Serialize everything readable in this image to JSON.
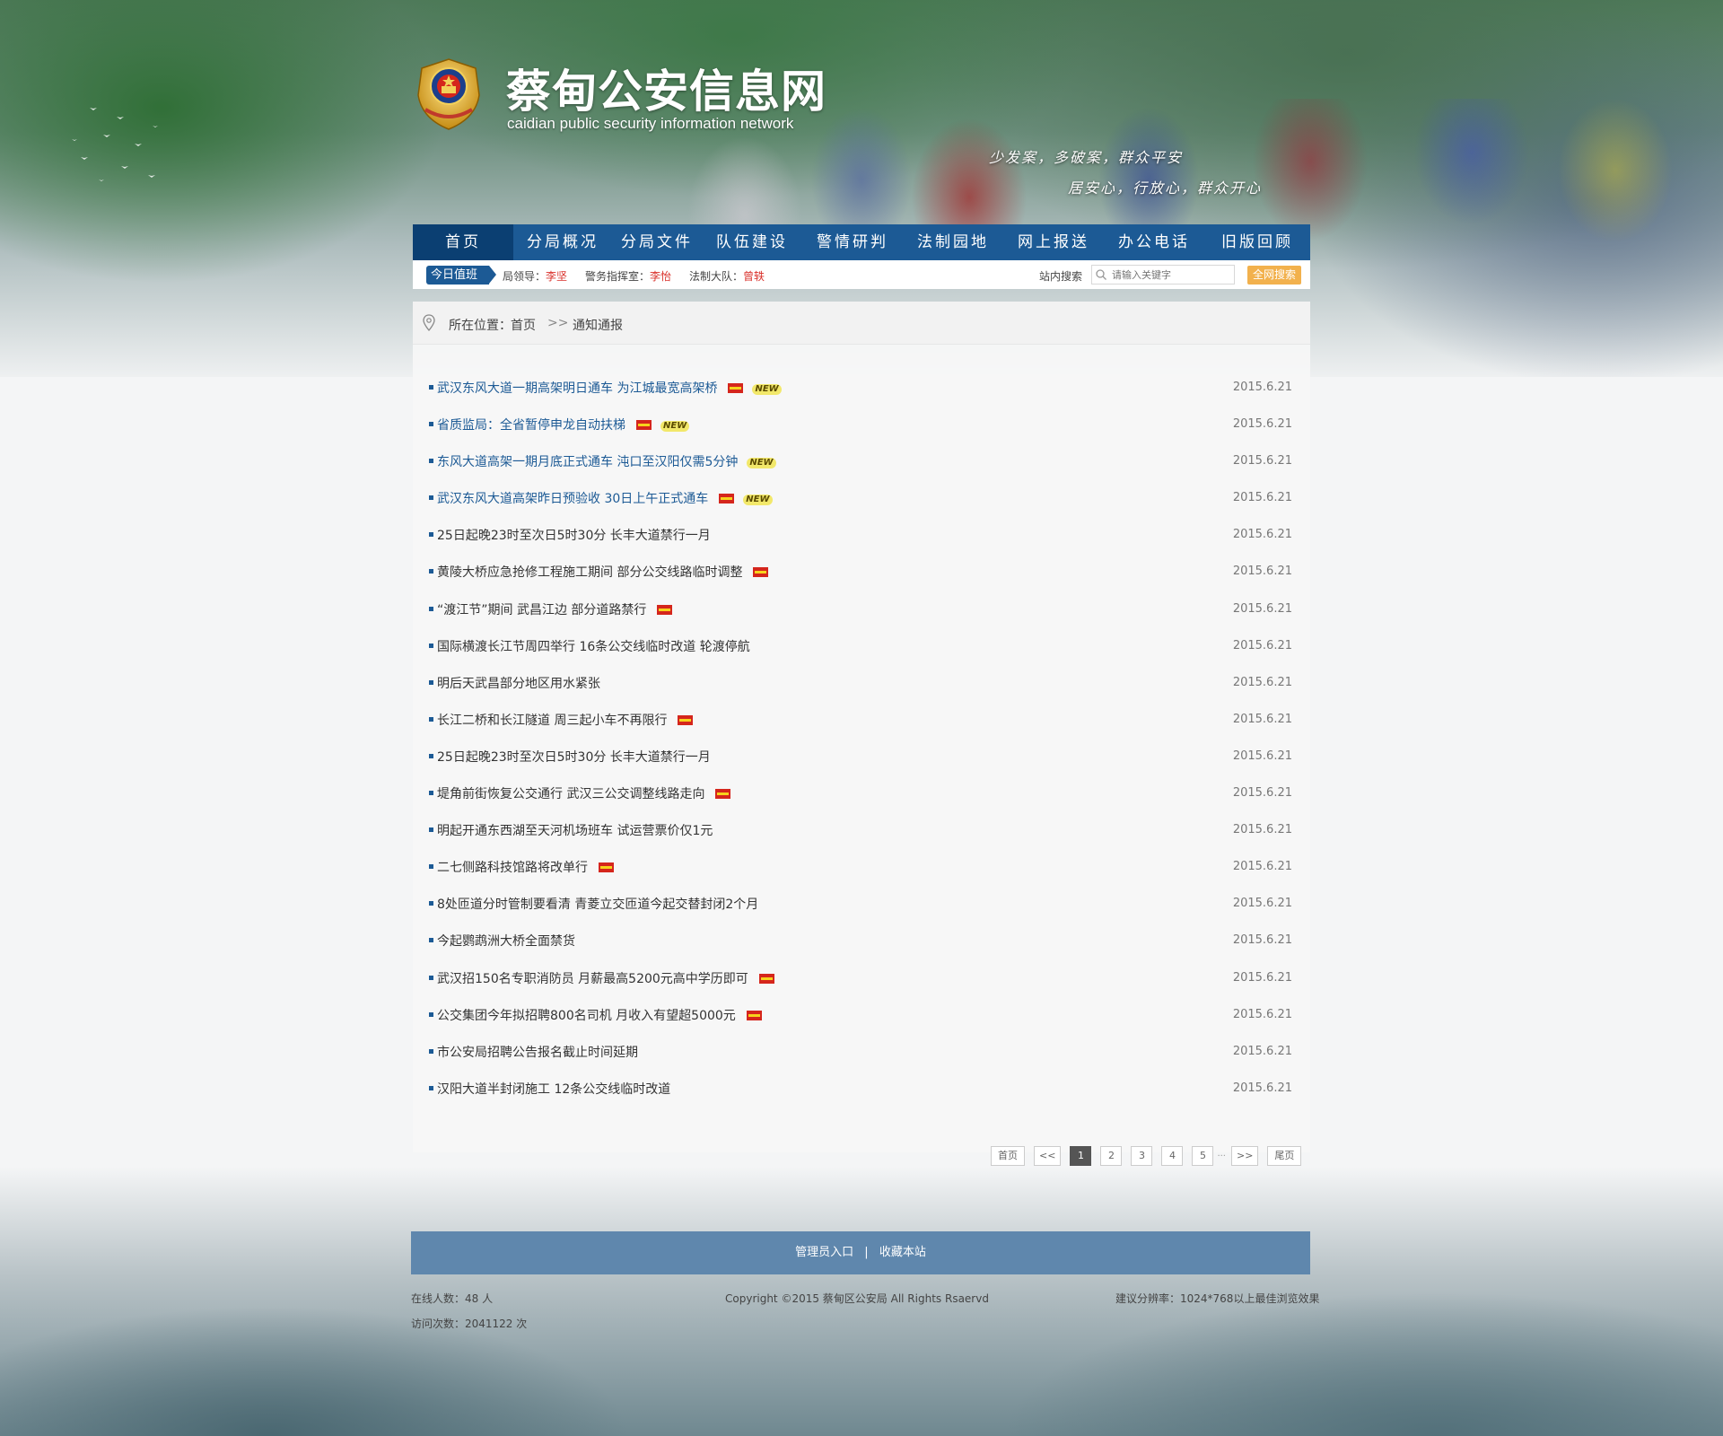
{
  "header": {
    "title": "蔡甸公安信息网",
    "subtitle": "caidian  public security information network",
    "slogan_1": "少发案，多破案，群众平安",
    "slogan_2": "居安心，行放心，群众开心"
  },
  "nav": {
    "items": [
      {
        "label": "首页"
      },
      {
        "label": "分局概况"
      },
      {
        "label": "分局文件"
      },
      {
        "label": "队伍建设"
      },
      {
        "label": "警情研判"
      },
      {
        "label": "法制园地"
      },
      {
        "label": "网上报送"
      },
      {
        "label": "办公电话"
      },
      {
        "label": "旧版回顾"
      }
    ]
  },
  "duty": {
    "tag": "今日值班",
    "items": [
      {
        "role": "局领导：",
        "name": "李坚"
      },
      {
        "role": "警务指挥室：",
        "name": "李怡"
      },
      {
        "role": "法制大队：",
        "name": "曾轶"
      }
    ]
  },
  "search": {
    "label": "站内搜索",
    "placeholder": "请输入关键字",
    "button": "全网搜索"
  },
  "breadcrumb": {
    "label": "所在位置：",
    "home": "首页",
    "separator": ">>",
    "current": "通知通报"
  },
  "news": [
    {
      "title": "武汉东风大道一期高架明日通车  为江城最宽高架桥",
      "date": "2015.6.21",
      "flag": true,
      "new": true,
      "hot": true
    },
    {
      "title": "省质监局：全省暂停申龙自动扶梯",
      "date": "2015.6.21",
      "flag": true,
      "new": true,
      "hot": true
    },
    {
      "title": "东风大道高架一期月底正式通车  沌口至汉阳仅需5分钟",
      "date": "2015.6.21",
      "flag": false,
      "new": true,
      "hot": true
    },
    {
      "title": "武汉东风大道高架昨日预验收  30日上午正式通车",
      "date": "2015.6.21",
      "flag": true,
      "new": true,
      "hot": true
    },
    {
      "title": "25日起晚23时至次日5时30分  长丰大道禁行一月",
      "date": "2015.6.21",
      "flag": false,
      "new": false,
      "hot": false
    },
    {
      "title": "黄陵大桥应急抢修工程施工期间  部分公交线路临时调整",
      "date": "2015.6.21",
      "flag": true,
      "new": false,
      "hot": false
    },
    {
      "title": "“渡江节”期间  武昌江边  部分道路禁行",
      "date": "2015.6.21",
      "flag": true,
      "new": false,
      "hot": false
    },
    {
      "title": "国际横渡长江节周四举行  16条公交线临时改道  轮渡停航",
      "date": "2015.6.21",
      "flag": false,
      "new": false,
      "hot": false
    },
    {
      "title": "明后天武昌部分地区用水紧张",
      "date": "2015.6.21",
      "flag": false,
      "new": false,
      "hot": false
    },
    {
      "title": "长江二桥和长江隧道  周三起小车不再限行",
      "date": "2015.6.21",
      "flag": true,
      "new": false,
      "hot": false
    },
    {
      "title": "25日起晚23时至次日5时30分  长丰大道禁行一月",
      "date": "2015.6.21",
      "flag": false,
      "new": false,
      "hot": false
    },
    {
      "title": "堤角前街恢复公交通行  武汉三公交调整线路走向",
      "date": "2015.6.21",
      "flag": true,
      "new": false,
      "hot": false
    },
    {
      "title": "明起开通东西湖至天河机场班车  试运营票价仅1元",
      "date": "2015.6.21",
      "flag": false,
      "new": false,
      "hot": false
    },
    {
      "title": "二七侧路科技馆路将改单行",
      "date": "2015.6.21",
      "flag": true,
      "new": false,
      "hot": false
    },
    {
      "title": "8处匝道分时管制要看清  青菱立交匝道今起交替封闭2个月",
      "date": "2015.6.21",
      "flag": false,
      "new": false,
      "hot": false
    },
    {
      "title": "今起鹦鹉洲大桥全面禁货",
      "date": "2015.6.21",
      "flag": false,
      "new": false,
      "hot": false
    },
    {
      "title": "武汉招150名专职消防员  月薪最高5200元高中学历即可",
      "date": "2015.6.21",
      "flag": true,
      "new": false,
      "hot": false
    },
    {
      "title": "公交集团今年拟招聘800名司机  月收入有望超5000元",
      "date": "2015.6.21",
      "flag": true,
      "new": false,
      "hot": false
    },
    {
      "title": "市公安局招聘公告报名截止时间延期",
      "date": "2015.6.21",
      "flag": false,
      "new": false,
      "hot": false
    },
    {
      "title": "汉阳大道半封闭施工  12条公交线临时改道",
      "date": "2015.6.21",
      "flag": false,
      "new": false,
      "hot": false
    }
  ],
  "badge_new_text": "NEW",
  "pagination": {
    "first": "首页",
    "prev": "<<",
    "pages": [
      "1",
      "2",
      "3",
      "4",
      "5"
    ],
    "current": "1",
    "ellipsis": "···",
    "next": ">>",
    "last": "尾页"
  },
  "footer": {
    "admin_link": "管理员入口",
    "divider": "|",
    "favorite_link": "收藏本站",
    "online": "在线人数：48 人",
    "visits": "访问次数：2041122 次",
    "copyright": "Copyright ©2015   蔡甸区公安局   All Rights Rsaervd",
    "resolution": "建议分辨率：1024*768以上最佳浏览效果"
  },
  "colors": {
    "nav_bg": "#1c5a95",
    "nav_active": "#0b3f72",
    "duty_name": "#d9302a",
    "search_button": "#f2b14d",
    "footer_bar": "#5f87ad"
  }
}
